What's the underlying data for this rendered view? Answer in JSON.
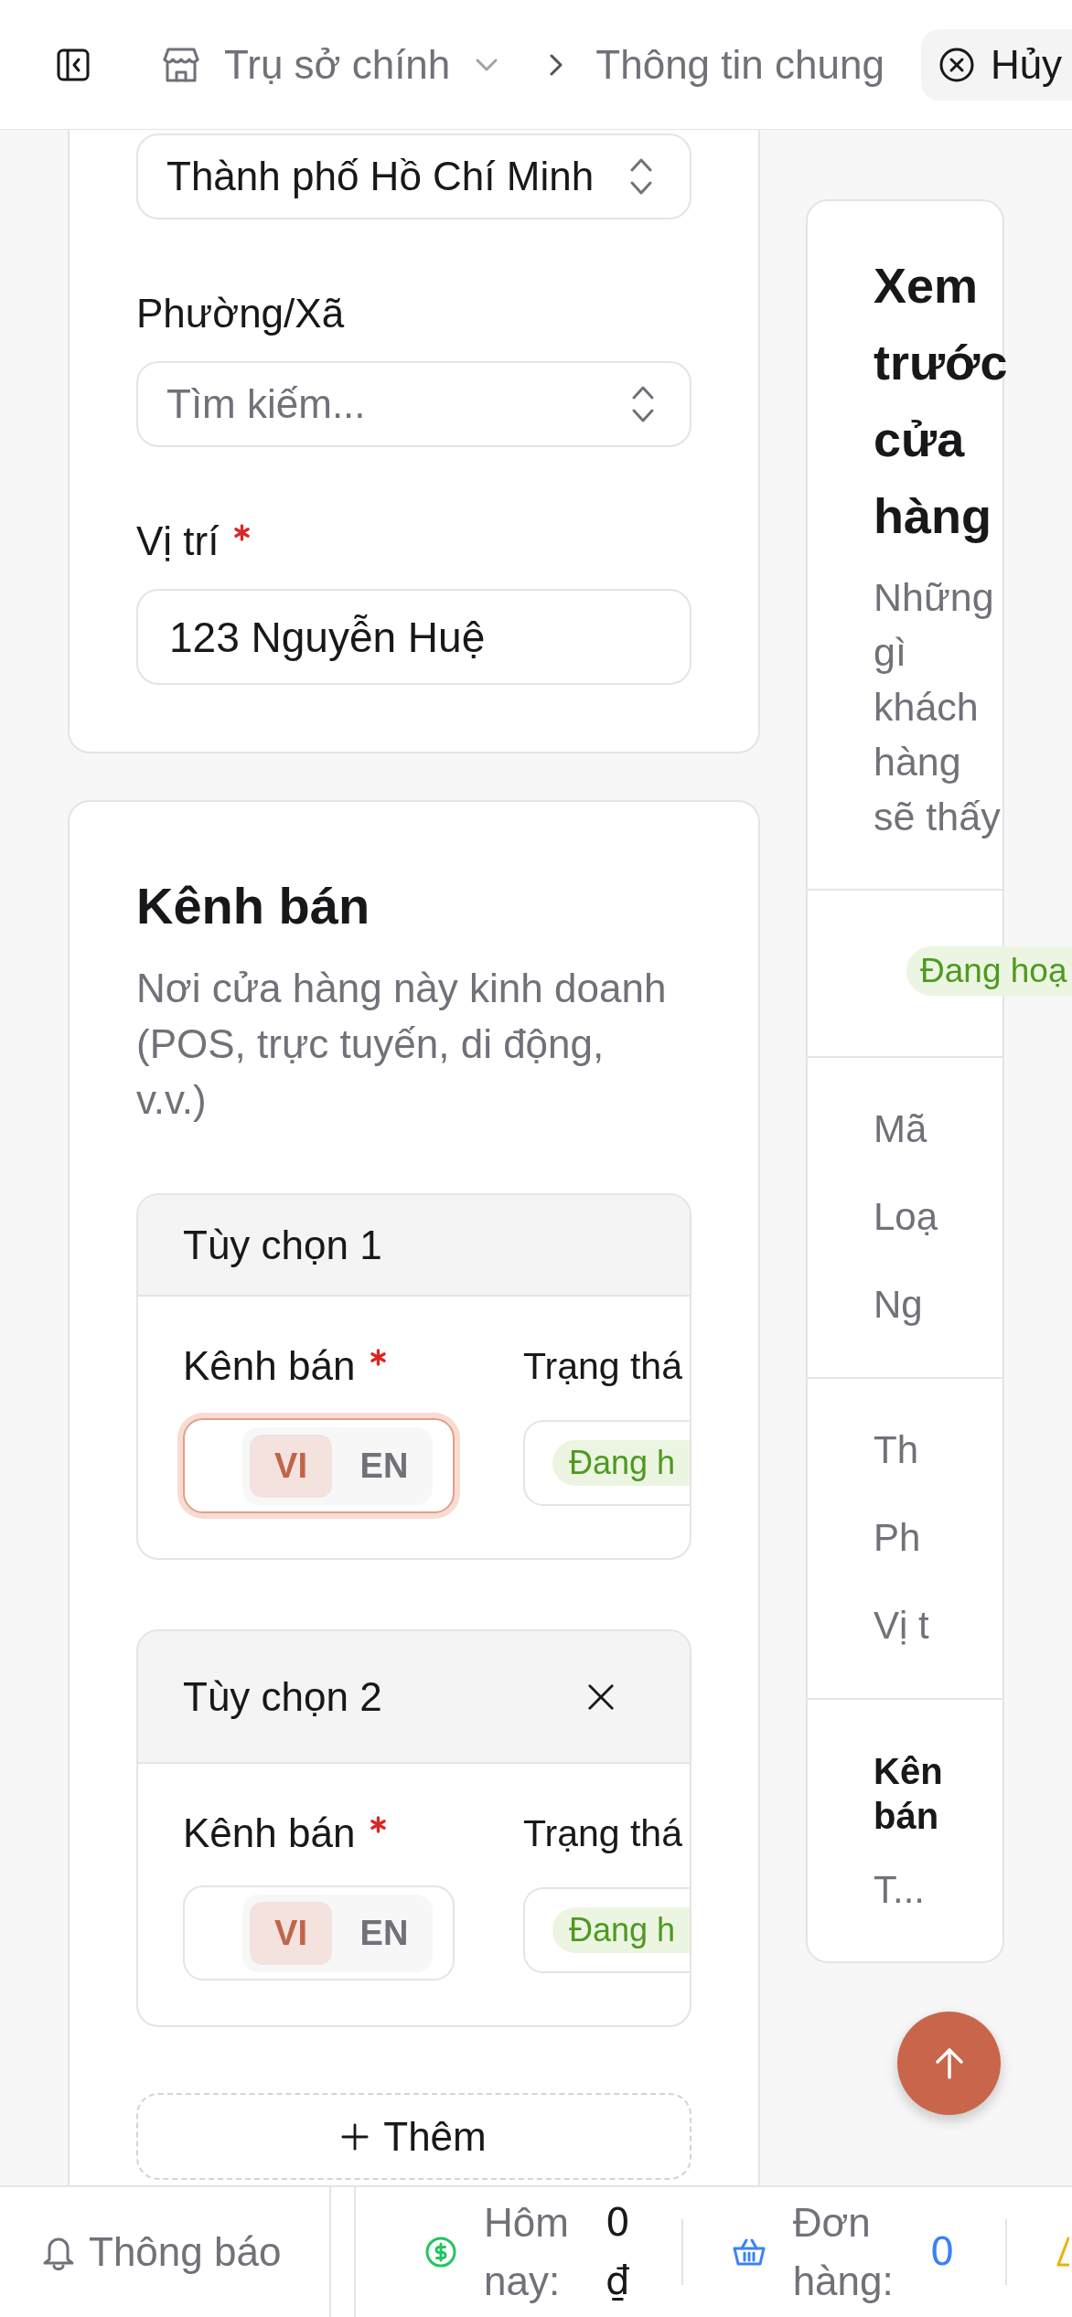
{
  "top_bar": {
    "breadcrumb": [
      {
        "kind": "store",
        "label": "Trụ sở chính"
      },
      {
        "kind": "page",
        "label": "Thông tin chung"
      }
    ],
    "cancel_button": "Hủy"
  },
  "location_card": {
    "city_select": {
      "value": "Thành phố Hồ Chí Minh"
    },
    "ward": {
      "label": "Phường/Xã",
      "required": false,
      "placeholder": "Tìm kiếm..."
    },
    "address": {
      "label": "Vị trí",
      "required": true,
      "value": "123 Nguyễn Huệ"
    }
  },
  "channels_card": {
    "title": "Kênh bán",
    "description": "Nơi cửa hàng này kinh doanh (POS, trực tuyến, di động, v.v.)",
    "options": [
      {
        "title": "Tùy chọn 1",
        "removable": false,
        "channel_label": "Kênh bán",
        "required": true,
        "focused": true,
        "languages": [
          {
            "label": "VI",
            "selected": true
          },
          {
            "label": "EN",
            "selected": false
          }
        ],
        "status_label": "Trạng thá",
        "status": "Đang h"
      },
      {
        "title": "Tùy chọn 2",
        "removable": true,
        "channel_label": "Kênh bán",
        "required": true,
        "focused": false,
        "languages": [
          {
            "label": "VI",
            "selected": true
          },
          {
            "label": "EN",
            "selected": false
          }
        ],
        "status_label": "Trạng thá",
        "status": "Đang h"
      }
    ],
    "add_button": "Thêm"
  },
  "preview": {
    "title": "Xem trước cửa hàng",
    "subtitle": "Những gì khách hàng sẽ thấy",
    "status": "Đang hoạ",
    "sections": [
      {
        "rows": [
          "Mã",
          "Loạ",
          "Ng"
        ]
      },
      {
        "rows": [
          "Th",
          "Ph",
          "Vị t"
        ]
      },
      {
        "heading": "Kên bán",
        "rows": [
          "T..."
        ]
      }
    ]
  },
  "status_bar": {
    "notifications": "Thông báo",
    "stats": [
      {
        "kind": "revenue",
        "label": "Hôm nay:",
        "value": "0 ₫"
      },
      {
        "kind": "orders",
        "label": "Đơn hàng:",
        "value": "0"
      },
      {
        "kind": "warning"
      }
    ]
  }
}
